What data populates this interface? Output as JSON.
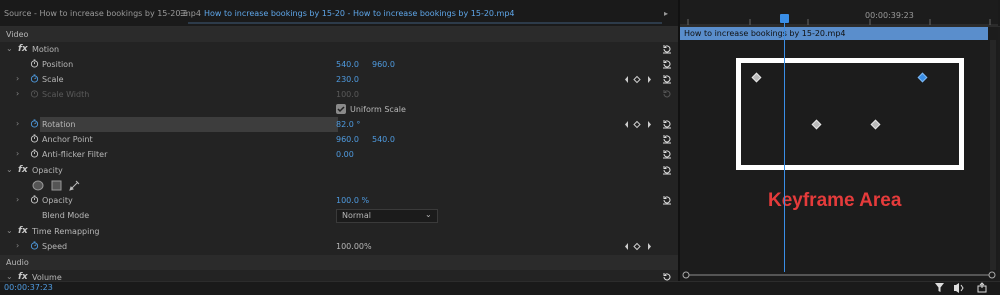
{
  "tabs": {
    "source": "Source - How to increase bookings by 15-20.mp4",
    "effect_controls": "How to increase bookings by 15-20 - How to increase bookings by 15-20.mp4"
  },
  "timeline": {
    "timecode": "00:00:39:23",
    "clip_name": "How to increase bookings by 15-20.mp4"
  },
  "sections": {
    "video": "Video",
    "audio": "Audio"
  },
  "effects": {
    "motion": {
      "label": "Motion",
      "position": {
        "label": "Position",
        "x": "540.0",
        "y": "960.0"
      },
      "scale": {
        "label": "Scale",
        "value": "230.0"
      },
      "scale_width": {
        "label": "Scale Width",
        "value": "100.0"
      },
      "uniform_scale": "Uniform Scale",
      "rotation": {
        "label": "Rotation",
        "value": "82.0 °"
      },
      "anchor_point": {
        "label": "Anchor Point",
        "x": "960.0",
        "y": "540.0"
      },
      "anti_flicker": {
        "label": "Anti-flicker Filter",
        "value": "0.00"
      }
    },
    "opacity": {
      "label": "Opacity",
      "opacity": {
        "label": "Opacity",
        "value": "100.0 %"
      },
      "blend_mode": {
        "label": "Blend Mode",
        "value": "Normal"
      }
    },
    "time_remapping": {
      "label": "Time Remapping",
      "speed": {
        "label": "Speed",
        "value": "100.00%"
      }
    },
    "volume": {
      "label": "Volume"
    }
  },
  "annotation": "Keyframe Area",
  "footer": {
    "timecode": "00:00:37:23"
  },
  "colors": {
    "accent": "#4f9be0",
    "clip_bar": "#5a8ecc",
    "annotation": "#e53b3b",
    "keyframe_selected": "#3a8ee6"
  }
}
